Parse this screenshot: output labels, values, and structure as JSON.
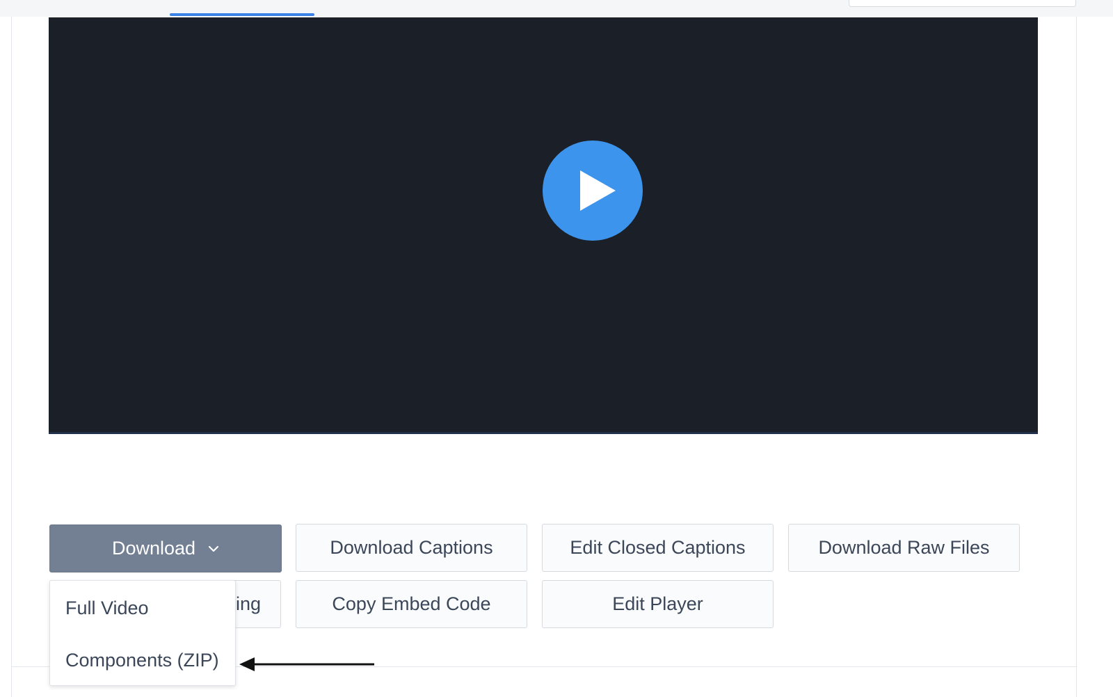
{
  "buttons": {
    "download": "Download",
    "download_captions": "Download Captions",
    "edit_closed_captions": "Edit Closed Captions",
    "download_raw_files": "Download Raw Files",
    "hidden_partial": "ing",
    "copy_embed_code": "Copy Embed Code",
    "edit_player": "Edit Player"
  },
  "download_menu": {
    "items": [
      {
        "label": "Full Video"
      },
      {
        "label": "Components (ZIP)"
      }
    ]
  },
  "icons": {
    "play": "play-icon",
    "chevron": "chevron-down-icon",
    "arrow": "arrow-left-icon"
  },
  "colors": {
    "player_bg": "#1b1f27",
    "play_button": "#3d94ec",
    "primary_button": "#737f92",
    "tab_indicator": "#3b82e6"
  }
}
